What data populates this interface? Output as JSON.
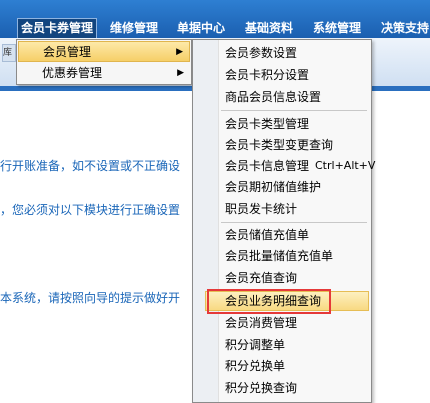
{
  "menubar": {
    "items": [
      "会员卡券管理",
      "维修管理",
      "单据中心",
      "基础资料",
      "系统管理",
      "决策支持"
    ]
  },
  "toolbar": {
    "fragment": "库"
  },
  "background": {
    "line1": "行开账准备，如不设置或不正确设",
    "line2": "，您必须对以下模块进行正确设置",
    "line3": "本系统，请按照向导的提示做好开"
  },
  "menu1": {
    "items": [
      {
        "label": "会员管理"
      },
      {
        "label": "优惠券管理"
      }
    ]
  },
  "menu2": {
    "items": [
      {
        "label": "会员参数设置"
      },
      {
        "label": "会员卡积分设置"
      },
      {
        "label": "商品会员信息设置"
      },
      {
        "label": "会员卡类型管理"
      },
      {
        "label": "会员卡类型变更查询"
      },
      {
        "label": "会员卡信息管理",
        "shortcut": "Ctrl+Alt+V"
      },
      {
        "label": "会员期初储值维护"
      },
      {
        "label": "职员发卡统计"
      },
      {
        "label": "会员储值充值单"
      },
      {
        "label": "会员批量储值充值单"
      },
      {
        "label": "会员充值查询"
      },
      {
        "label": "会员业务明细查询"
      },
      {
        "label": "会员消费管理"
      },
      {
        "label": "积分调整单"
      },
      {
        "label": "积分兑换单"
      },
      {
        "label": "积分兑换查询"
      }
    ]
  }
}
